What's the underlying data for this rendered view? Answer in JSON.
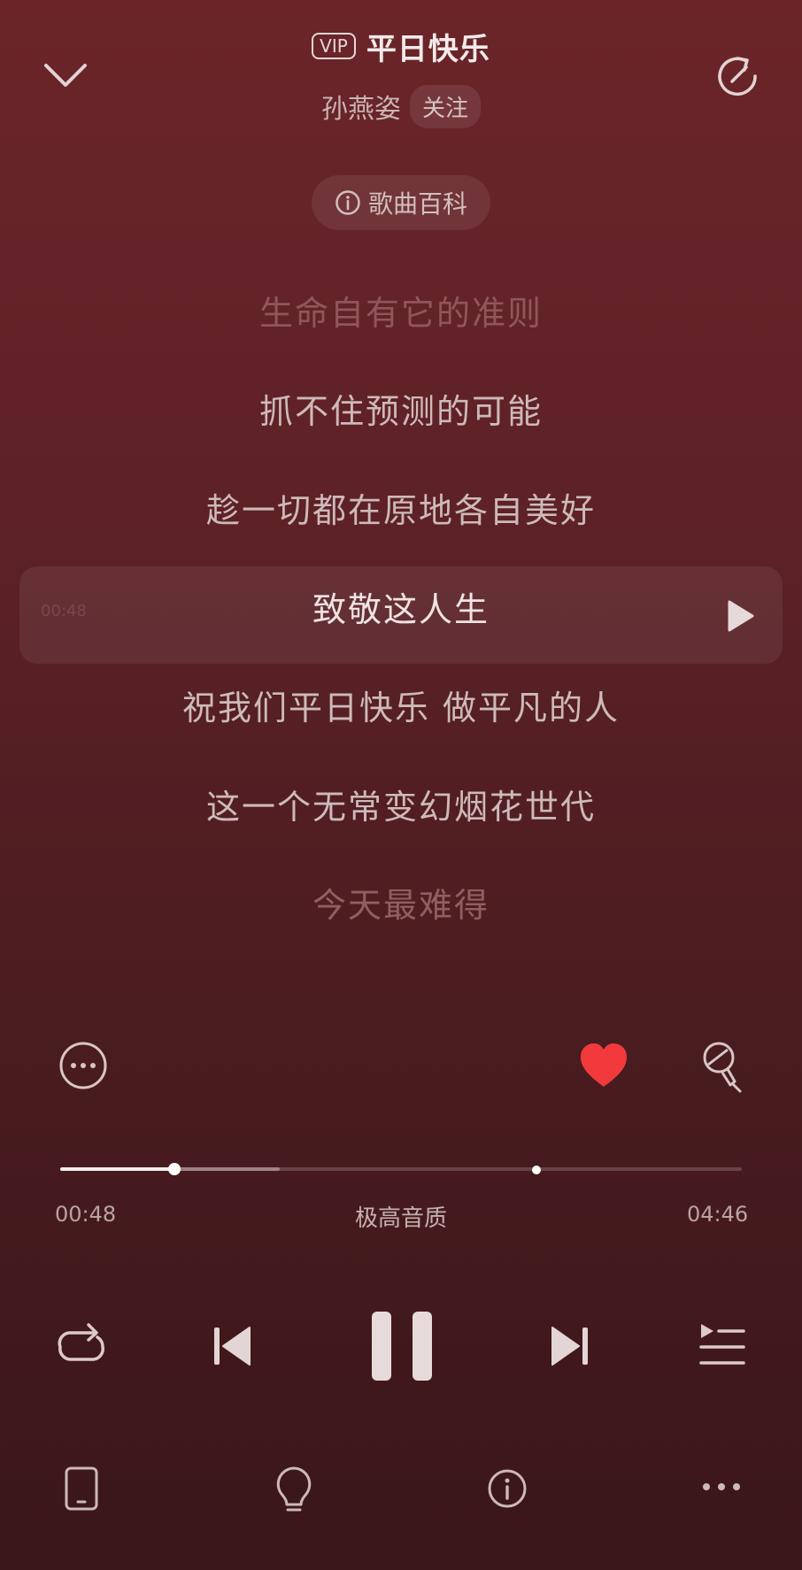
{
  "header": {
    "vip_label": "VIP",
    "title": "平日快乐",
    "artist": "孙燕姿",
    "follow_label": "关注",
    "wiki_label": "歌曲百科"
  },
  "lyrics": {
    "lines": [
      "生命自有它的准则",
      "抓不住预测的可能",
      "趁一切都在原地各自美好",
      "致敬这人生",
      "祝我们平日快乐  做平凡的人",
      "这一个无常变幻烟花世代",
      "今天最难得"
    ],
    "current_index": 3,
    "current_line_time": "00:48"
  },
  "player": {
    "time_current": "00:48",
    "time_total": "04:46",
    "quality": "极高音质",
    "progress_fraction": 0.168,
    "buffered_fraction": 0.322,
    "liked": true
  },
  "colors": {
    "like": "#f23a3c",
    "bg_top": "#6b2529",
    "bg_bottom": "#3a1619"
  },
  "icons": {
    "collapse": "chevron-down-icon",
    "refresh": "refresh-icon",
    "wiki": "info-icon",
    "more": "more-circle-icon",
    "like": "heart-icon",
    "sing": "microphone-icon",
    "repeat": "repeat-icon",
    "prev": "previous-icon",
    "pause": "pause-icon",
    "next": "next-icon",
    "playlist": "playlist-icon",
    "device": "phone-icon",
    "tip": "lightbulb-icon",
    "info": "info-icon",
    "overflow": "more-horizontal-icon"
  }
}
